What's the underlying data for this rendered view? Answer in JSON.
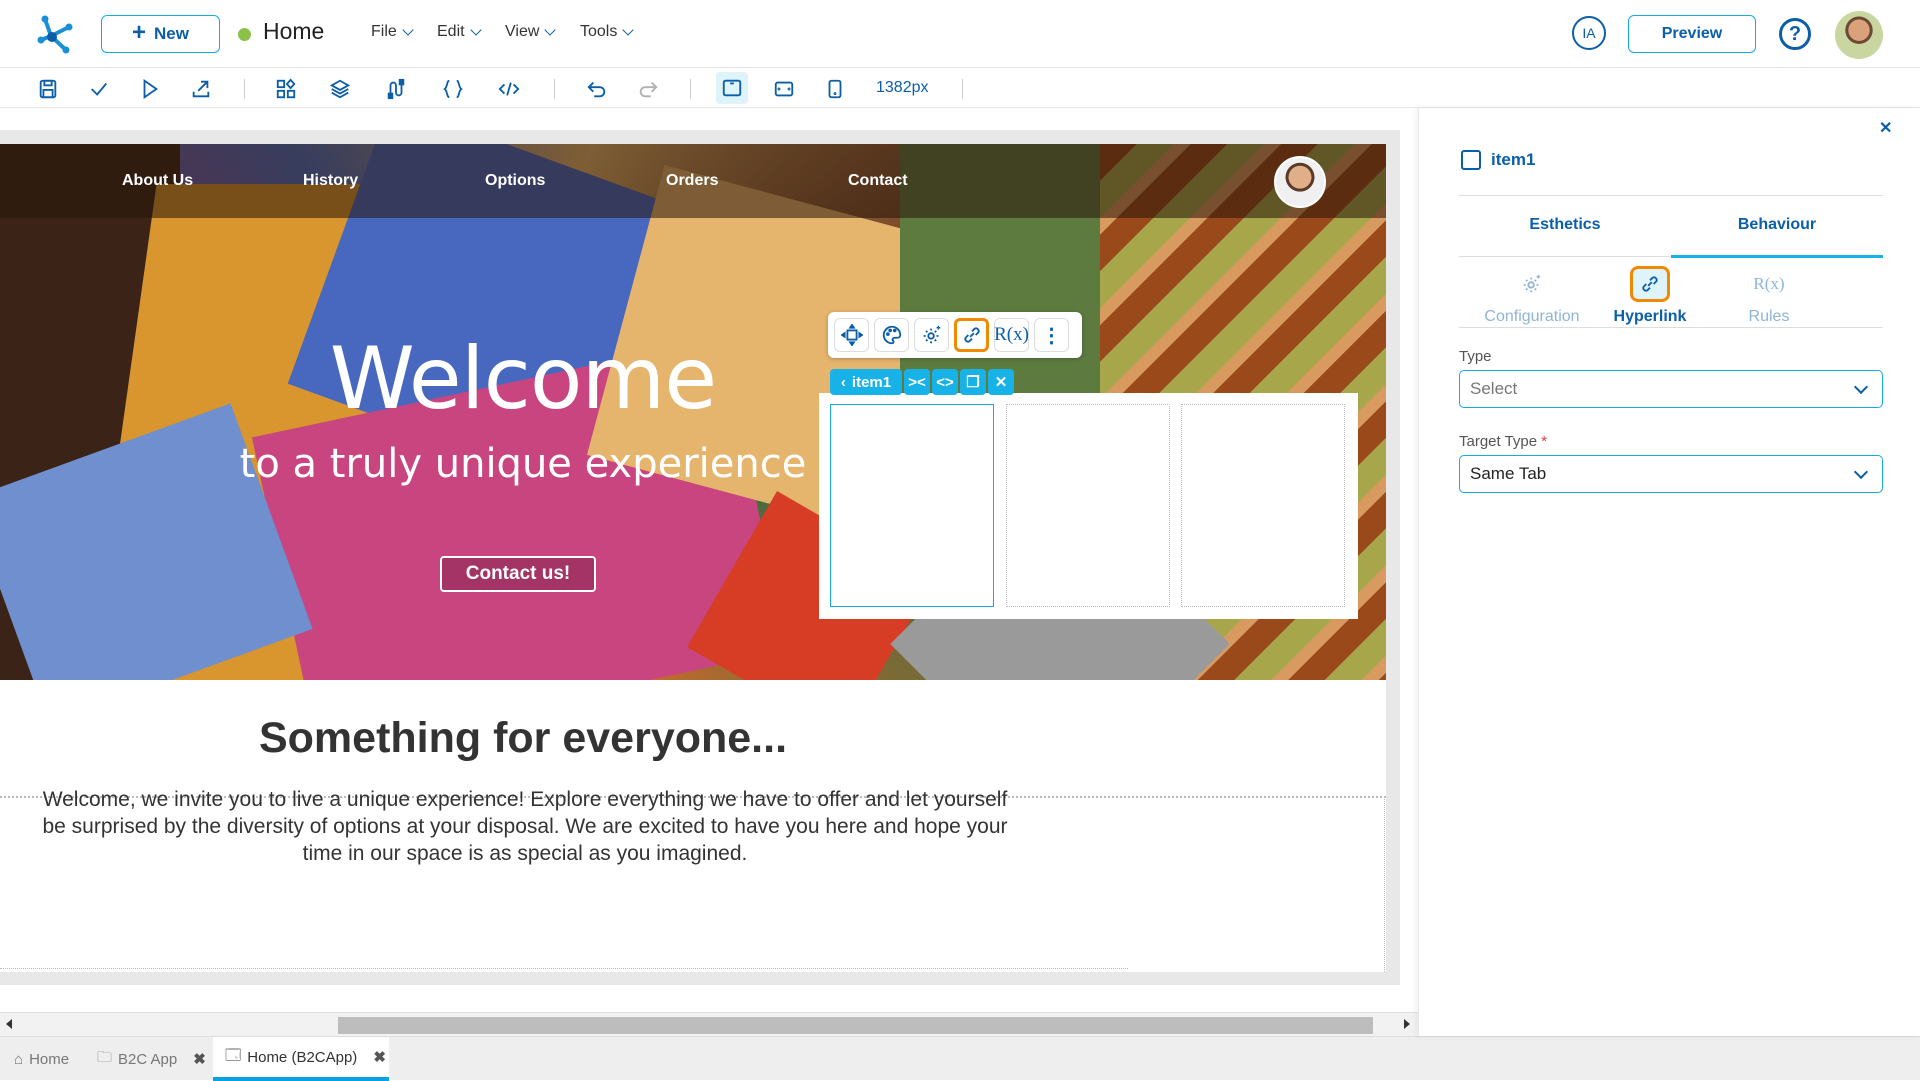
{
  "header": {
    "new_label": "New",
    "page_title": "Home",
    "status_color": "#8bc34a",
    "menus": [
      "File",
      "Edit",
      "View",
      "Tools"
    ],
    "ia_label": "IA",
    "preview_label": "Preview",
    "help_label": "?"
  },
  "toolbar": {
    "icons": [
      "save-icon",
      "check-icon",
      "play-icon",
      "export-icon",
      "components-icon",
      "layers-icon",
      "integrations-icon",
      "braces-icon",
      "code-icon",
      "undo-icon",
      "redo-icon",
      "desktop-view-icon",
      "tablet-view-icon",
      "mobile-view-icon"
    ],
    "width_readout": "1382px"
  },
  "site": {
    "nav": [
      "About Us",
      "History",
      "Options",
      "Orders",
      "Contact"
    ],
    "hero_title": "Welcome",
    "hero_subtitle": "to a truly unique experience",
    "contact_button": "Contact us!",
    "section_title": "Something for everyone...",
    "section_body": "Welcome, we invite you to live a unique experience! Explore everything we have to offer and let yourself be surprised by the diversity of options at your disposal. We are excited to have you here and hope your time in our space is as special as you imagined."
  },
  "selection": {
    "item_name": "item1",
    "float_tools": [
      "move-icon",
      "palette-icon",
      "settings-icon",
      "link-icon",
      "rules-icon",
      "more-icon"
    ],
    "rules_glyph": "R(x)"
  },
  "panel": {
    "item_name": "item1",
    "tabs": [
      "Esthetics",
      "Behaviour"
    ],
    "active_tab": "Behaviour",
    "subtabs": [
      "Configuration",
      "Hyperlink",
      "Rules"
    ],
    "active_subtab": "Hyperlink",
    "rules_glyph": "R(x)",
    "type_label": "Type",
    "type_value": "Select",
    "target_type_label": "Target Type",
    "target_type_required": "*",
    "target_type_value": "Same Tab"
  },
  "bottom_tabs": [
    {
      "label": "Home",
      "icon": "home-icon",
      "closable": false
    },
    {
      "label": "B2C App",
      "icon": "folder-icon",
      "closable": true
    },
    {
      "label": "Home (B2CApp)",
      "icon": "page-icon",
      "closable": true,
      "active": true
    }
  ],
  "colors": {
    "primary": "#0b5ea8",
    "accent": "#17b2e8",
    "highlight": "#f08a00"
  }
}
